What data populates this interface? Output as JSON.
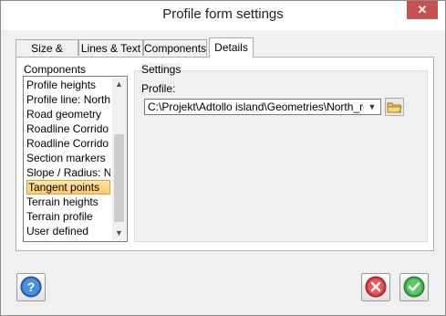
{
  "window": {
    "title": "Profile form settings",
    "close_glyph": "✕"
  },
  "tabs": [
    {
      "label": "Size & Scale"
    },
    {
      "label": "Lines & Text"
    },
    {
      "label": "Components"
    },
    {
      "label": "Details",
      "active": true
    }
  ],
  "components": {
    "label": "Components",
    "items": [
      "Profile heights",
      "Profile line: North",
      "Road geometry",
      "Roadline Corrido",
      "Roadline Corrido",
      "Section markers",
      "Slope / Radius: N",
      "Tangent points",
      "Terrain heights",
      "Terrain profile",
      "User defined"
    ],
    "selected_index": 7
  },
  "settings": {
    "group_label": "Settings",
    "profile_label": "Profile:",
    "profile_value": "C:\\Projekt\\Adtollo island\\Geometries\\North_road",
    "browse_icon": "folder-icon"
  },
  "buttons": {
    "help_icon": "help-icon",
    "cancel_icon": "cancel-icon",
    "ok_icon": "ok-check-icon"
  },
  "colors": {
    "selection": "#ffc86a",
    "help_blue": "#2a6fc0",
    "cancel_red": "#d03a3a",
    "ok_green": "#3aa845"
  }
}
